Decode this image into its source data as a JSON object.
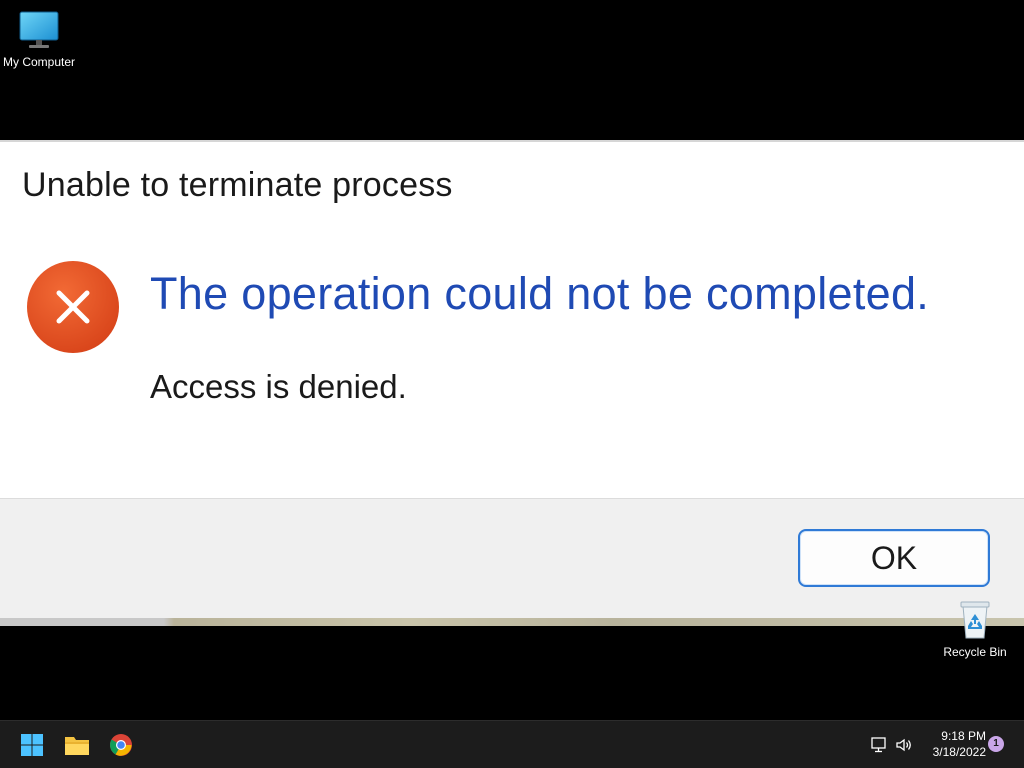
{
  "desktop": {
    "icons": [
      {
        "label": "My Computer",
        "icon": "monitor-icon"
      },
      {
        "label": "Recycle Bin",
        "icon": "recycle-bin-icon"
      }
    ]
  },
  "dialog": {
    "title": "Unable to terminate process",
    "icon": "error-icon",
    "main_instruction": "The operation could not be completed.",
    "content": "Access is denied.",
    "ok_label": "OK"
  },
  "taskbar": {
    "pinned": [
      {
        "name": "Start",
        "icon": "windows-start-icon"
      },
      {
        "name": "File Explorer",
        "icon": "folder-icon"
      },
      {
        "name": "Google Chrome",
        "icon": "chrome-icon"
      }
    ],
    "tray": {
      "icons": [
        "network-icon",
        "volume-icon"
      ],
      "time": "9:18 PM",
      "date": "3/18/2022",
      "notification_count": "1"
    }
  },
  "colors": {
    "desktop_background": "#000000",
    "dialog_background": "#ffffff",
    "main_instruction": "#1f4ab4",
    "error_icon": "#e0521f",
    "button_border": "#2f7ad6",
    "taskbar": "#1c1c1c"
  }
}
